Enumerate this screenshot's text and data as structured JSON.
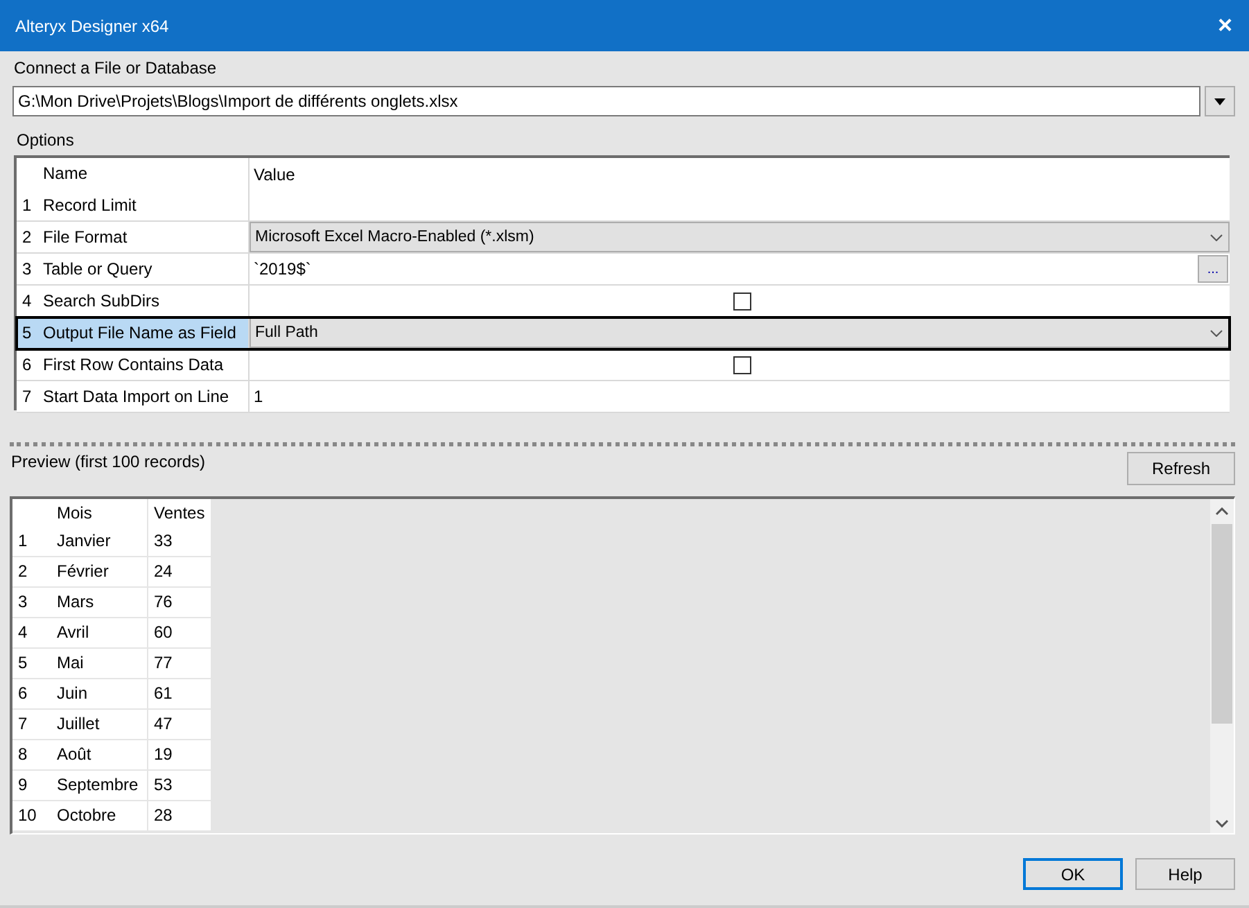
{
  "window": {
    "title": "Alteryx Designer x64",
    "close": "×"
  },
  "connect": {
    "label": "Connect a File or Database",
    "value": "G:\\Mon Drive\\Projets\\Blogs\\Import de différents onglets.xlsx"
  },
  "options": {
    "label": "Options",
    "columns": [
      "Name",
      "Value"
    ],
    "rows": [
      {
        "index": "1",
        "name": "Record Limit",
        "kind": "text",
        "value": "",
        "selected": false
      },
      {
        "index": "2",
        "name": "File Format",
        "kind": "dropdown",
        "value": "Microsoft Excel Macro-Enabled (*.xlsm)",
        "selected": false
      },
      {
        "index": "3",
        "name": "Table or Query",
        "kind": "browse",
        "value": "`2019$`",
        "button": "...",
        "selected": false
      },
      {
        "index": "4",
        "name": "Search SubDirs",
        "kind": "checkbox",
        "checked": false,
        "selected": false
      },
      {
        "index": "5",
        "name": "Output File Name as Field",
        "kind": "dropdown",
        "value": "Full Path",
        "selected": true
      },
      {
        "index": "6",
        "name": "First Row Contains Data",
        "kind": "checkbox",
        "checked": false,
        "selected": false
      },
      {
        "index": "7",
        "name": "Start Data Import on Line",
        "kind": "text",
        "value": "1",
        "selected": false
      }
    ]
  },
  "preview": {
    "label": "Preview (first 100 records)",
    "refresh": "Refresh",
    "columns": [
      "Mois",
      "Ventes"
    ],
    "rows": [
      {
        "index": "1",
        "cells": [
          "Janvier",
          "33"
        ]
      },
      {
        "index": "2",
        "cells": [
          "Février",
          "24"
        ]
      },
      {
        "index": "3",
        "cells": [
          "Mars",
          "76"
        ]
      },
      {
        "index": "4",
        "cells": [
          "Avril",
          "60"
        ]
      },
      {
        "index": "5",
        "cells": [
          "Mai",
          "77"
        ]
      },
      {
        "index": "6",
        "cells": [
          "Juin",
          "61"
        ]
      },
      {
        "index": "7",
        "cells": [
          "Juillet",
          "47"
        ]
      },
      {
        "index": "8",
        "cells": [
          "Août",
          "19"
        ]
      },
      {
        "index": "9",
        "cells": [
          "Septembre",
          "53"
        ]
      },
      {
        "index": "10",
        "cells": [
          "Octobre",
          "28"
        ]
      }
    ]
  },
  "buttons": [
    "OK",
    "Help"
  ]
}
